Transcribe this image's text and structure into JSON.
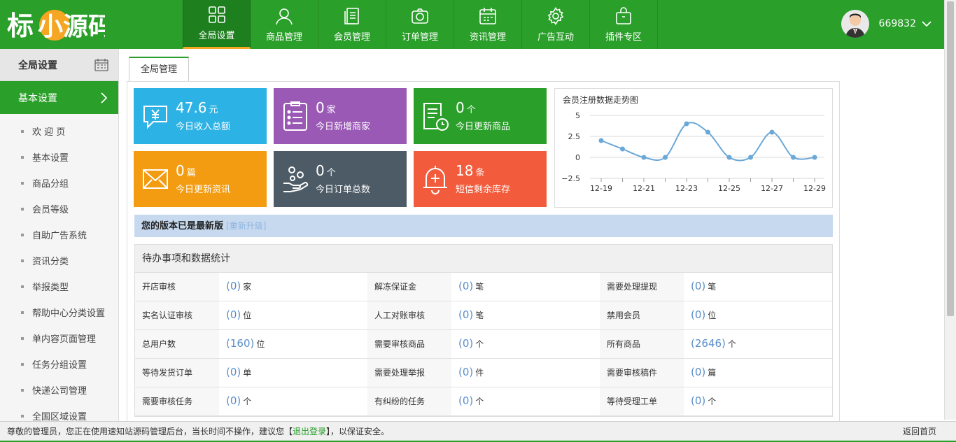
{
  "header": {
    "logo_text": "小源码",
    "nav": [
      {
        "label": "全局设置",
        "icon": "grid-icon"
      },
      {
        "label": "商品管理",
        "icon": "user-icon"
      },
      {
        "label": "会员管理",
        "icon": "document-icon"
      },
      {
        "label": "订单管理",
        "icon": "camera-icon"
      },
      {
        "label": "资讯管理",
        "icon": "calendar-icon"
      },
      {
        "label": "广告互动",
        "icon": "gear-icon"
      },
      {
        "label": "插件专区",
        "icon": "bag-icon"
      }
    ],
    "user_name": "669832"
  },
  "sidebar": {
    "title": "全局设置",
    "active": "基本设置",
    "items": [
      "欢 迎 页",
      "基本设置",
      "商品分组",
      "会员等级",
      "自助广告系统",
      "资讯分类",
      "举报类型",
      "帮助中心分类设置",
      "单内容页面管理",
      "任务分组设置",
      "快递公司管理",
      "全国区域设置"
    ]
  },
  "tab": "全局管理",
  "cards": [
    {
      "value": "47.6",
      "unit": "元",
      "label": "今日收入总额",
      "color": "#2cb2e4",
      "icon": "yuan-chat-icon"
    },
    {
      "value": "0",
      "unit": "家",
      "label": "今日新增商家",
      "color": "#9b59b6",
      "icon": "clipboard-icon"
    },
    {
      "value": "0",
      "unit": "个",
      "label": "今日更新商品",
      "color": "#2a9f2a",
      "icon": "doc-clock-icon"
    },
    {
      "value": "0",
      "unit": "篇",
      "label": "今日更新资讯",
      "color": "#f39c12",
      "icon": "envelope-icon"
    },
    {
      "value": "0",
      "unit": "个",
      "label": "今日订单总数",
      "color": "#4d5b66",
      "icon": "hand-coins-icon"
    },
    {
      "value": "18",
      "unit": "条",
      "label": "短信剩余库存",
      "color": "#f25c3d",
      "icon": "bell-plus-icon"
    }
  ],
  "chart_data": {
    "type": "line",
    "title": "会员注册数据走势图",
    "x": [
      "12-19",
      "12-20",
      "12-21",
      "12-22",
      "12-23",
      "12-24",
      "12-25",
      "12-26",
      "12-27",
      "12-28",
      "12-29"
    ],
    "tick_labels": [
      "12-19",
      "12-21",
      "12-23",
      "12-25",
      "12-27",
      "12-29"
    ],
    "values": [
      2,
      1,
      0,
      0,
      4,
      3,
      0,
      0,
      3,
      0,
      0
    ],
    "yticks": [
      "5",
      "2.5",
      "0",
      "−2.5"
    ],
    "ylim": [
      -2.5,
      5
    ],
    "color": "#6aa8d8",
    "grid": true
  },
  "notice": {
    "text": "您的版本已是最新版",
    "link": "[重新升级]"
  },
  "stats": {
    "title": "待办事项和数据统计",
    "rows": [
      [
        {
          "label": "开店审核",
          "num": "(0)",
          "unit": "家"
        },
        {
          "label": "解冻保证金",
          "num": "(0)",
          "unit": "笔"
        },
        {
          "label": "需要处理提现",
          "num": "(0)",
          "unit": "笔"
        }
      ],
      [
        {
          "label": "实名认证审核",
          "num": "(0)",
          "unit": "位"
        },
        {
          "label": "人工对账审核",
          "num": "(0)",
          "unit": "笔"
        },
        {
          "label": "禁用会员",
          "num": "(0)",
          "unit": "位"
        }
      ],
      [
        {
          "label": "总用户数",
          "num": "(160)",
          "unit": "位"
        },
        {
          "label": "需要审核商品",
          "num": "(0)",
          "unit": "个"
        },
        {
          "label": "所有商品",
          "num": "(2646)",
          "unit": "个"
        }
      ],
      [
        {
          "label": "等待发货订单",
          "num": "(0)",
          "unit": "单"
        },
        {
          "label": "需要处理举报",
          "num": "(0)",
          "unit": "件"
        },
        {
          "label": "需要审核稿件",
          "num": "(0)",
          "unit": "篇"
        }
      ],
      [
        {
          "label": "需要审核任务",
          "num": "(0)",
          "unit": "个"
        },
        {
          "label": "有纠纷的任务",
          "num": "(0)",
          "unit": "个"
        },
        {
          "label": "等待受理工单",
          "num": "(0)",
          "unit": "个"
        }
      ]
    ]
  },
  "footer": {
    "text_before": "尊敬的管理员，您正在使用速知站源码管理后台，当长时间不操作，建议您【",
    "logout": "退出登录",
    "text_after": "】，以保证安全。",
    "back_home": "返回首页"
  }
}
